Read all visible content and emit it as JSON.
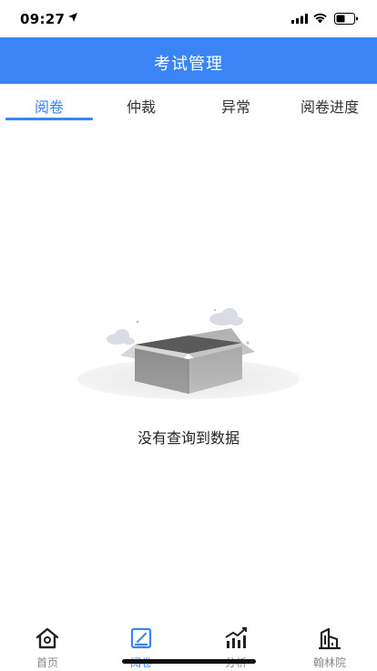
{
  "status_bar": {
    "time": "09:27"
  },
  "header": {
    "title": "考试管理"
  },
  "tabs": [
    {
      "label": "阅卷",
      "active": true
    },
    {
      "label": "仲裁",
      "active": false
    },
    {
      "label": "异常",
      "active": false
    },
    {
      "label": "阅卷进度",
      "active": false
    }
  ],
  "empty_state": {
    "message": "没有查询到数据"
  },
  "bottom_nav": [
    {
      "label": "首页",
      "icon": "home-icon",
      "active": false
    },
    {
      "label": "阅卷",
      "icon": "edit-icon",
      "active": true
    },
    {
      "label": "分析",
      "icon": "chart-icon",
      "active": false
    },
    {
      "label": "翰林院",
      "icon": "building-icon",
      "active": false
    }
  ],
  "colors": {
    "primary": "#3a84f5",
    "inactive": "#888888",
    "text": "#333333"
  }
}
